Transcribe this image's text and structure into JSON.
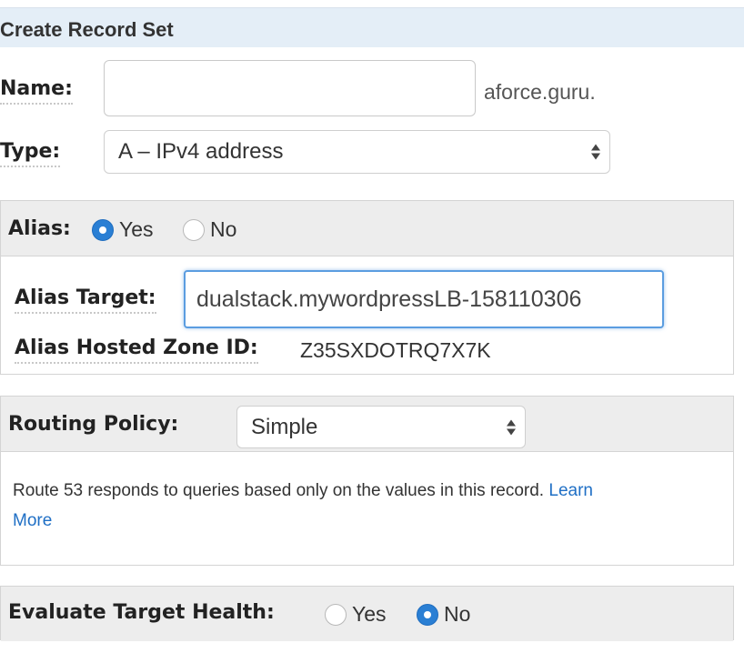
{
  "header": {
    "title": "Create Record Set"
  },
  "name": {
    "label": "Name:",
    "value": "",
    "suffix": "aforce.guru."
  },
  "type": {
    "label": "Type:",
    "selected": "A – IPv4 address"
  },
  "alias": {
    "label": "Alias:",
    "options": [
      "Yes",
      "No"
    ],
    "selected": "Yes",
    "target_label": "Alias Target:",
    "target_value": "dualstack.mywordpressLB-158110306",
    "zone_label": "Alias Hosted Zone ID:",
    "zone_value": "Z35SXDOTRQ7X7K"
  },
  "routing": {
    "label": "Routing Policy:",
    "selected": "Simple",
    "description": "Route 53 responds to queries based only on the values in this record.",
    "link_word1": "Learn",
    "link_word2": "More"
  },
  "health": {
    "label": "Evaluate Target Health:",
    "options": [
      "Yes",
      "No"
    ],
    "selected": "No"
  },
  "colors": {
    "accent": "#2a7fd4",
    "header_bg": "#e4eef7",
    "link": "#1f6fc5"
  }
}
